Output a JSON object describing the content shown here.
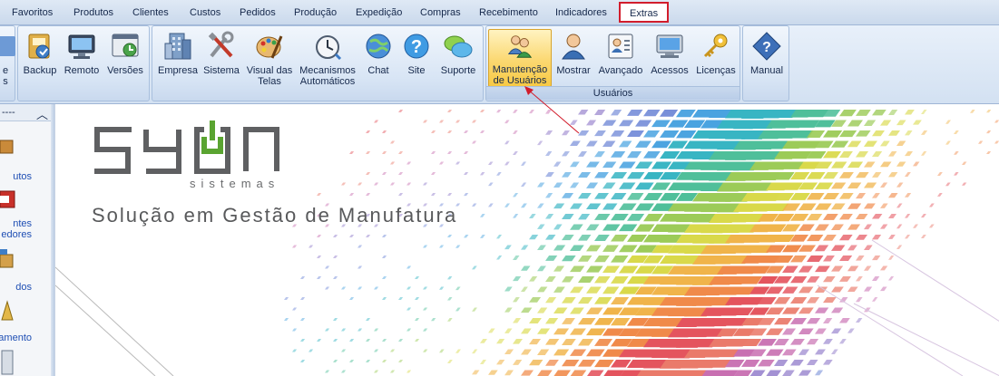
{
  "menu": {
    "tabs": [
      {
        "label": "Favoritos"
      },
      {
        "label": "Produtos"
      },
      {
        "label": "Clientes"
      },
      {
        "label": "Custos"
      },
      {
        "label": "Pedidos"
      },
      {
        "label": "Produção"
      },
      {
        "label": "Expedição"
      },
      {
        "label": "Compras"
      },
      {
        "label": "Recebimento"
      },
      {
        "label": "Indicadores"
      },
      {
        "label": "Extras"
      }
    ],
    "active_tab": "Extras"
  },
  "ribbon": {
    "partial_left_label": "e\ns",
    "group1": {
      "buttons": [
        {
          "label": "Backup"
        },
        {
          "label": "Remoto"
        },
        {
          "label": "Versões"
        }
      ]
    },
    "group2": {
      "buttons": [
        {
          "label": "Empresa"
        },
        {
          "label": "Sistema"
        },
        {
          "label": "Visual das\nTelas"
        },
        {
          "label": "Mecanismos\nAutomáticos"
        },
        {
          "label": "Chat"
        },
        {
          "label": "Site"
        },
        {
          "label": "Suporte"
        }
      ]
    },
    "group_usuarios": {
      "label": "Usuários",
      "buttons": [
        {
          "label": "Manutenção\nde Usuários"
        },
        {
          "label": "Mostrar"
        },
        {
          "label": "Avançado"
        },
        {
          "label": "Acessos"
        },
        {
          "label": "Licenças"
        }
      ]
    },
    "group_manual": {
      "buttons": [
        {
          "label": "Manual"
        }
      ]
    }
  },
  "leftnav": {
    "header": "----",
    "items": [
      {
        "label": "utos"
      },
      {
        "label": "ntes\nedores"
      },
      {
        "label": "dos"
      },
      {
        "label": "amento"
      }
    ]
  },
  "main": {
    "logo_sub": "sistemas",
    "tagline": "Solução em Gestão de Manufatura"
  },
  "colors": {
    "highlight": "#d21d2c",
    "ribbon_active": "#fbd871",
    "link": "#1f4fb4"
  }
}
